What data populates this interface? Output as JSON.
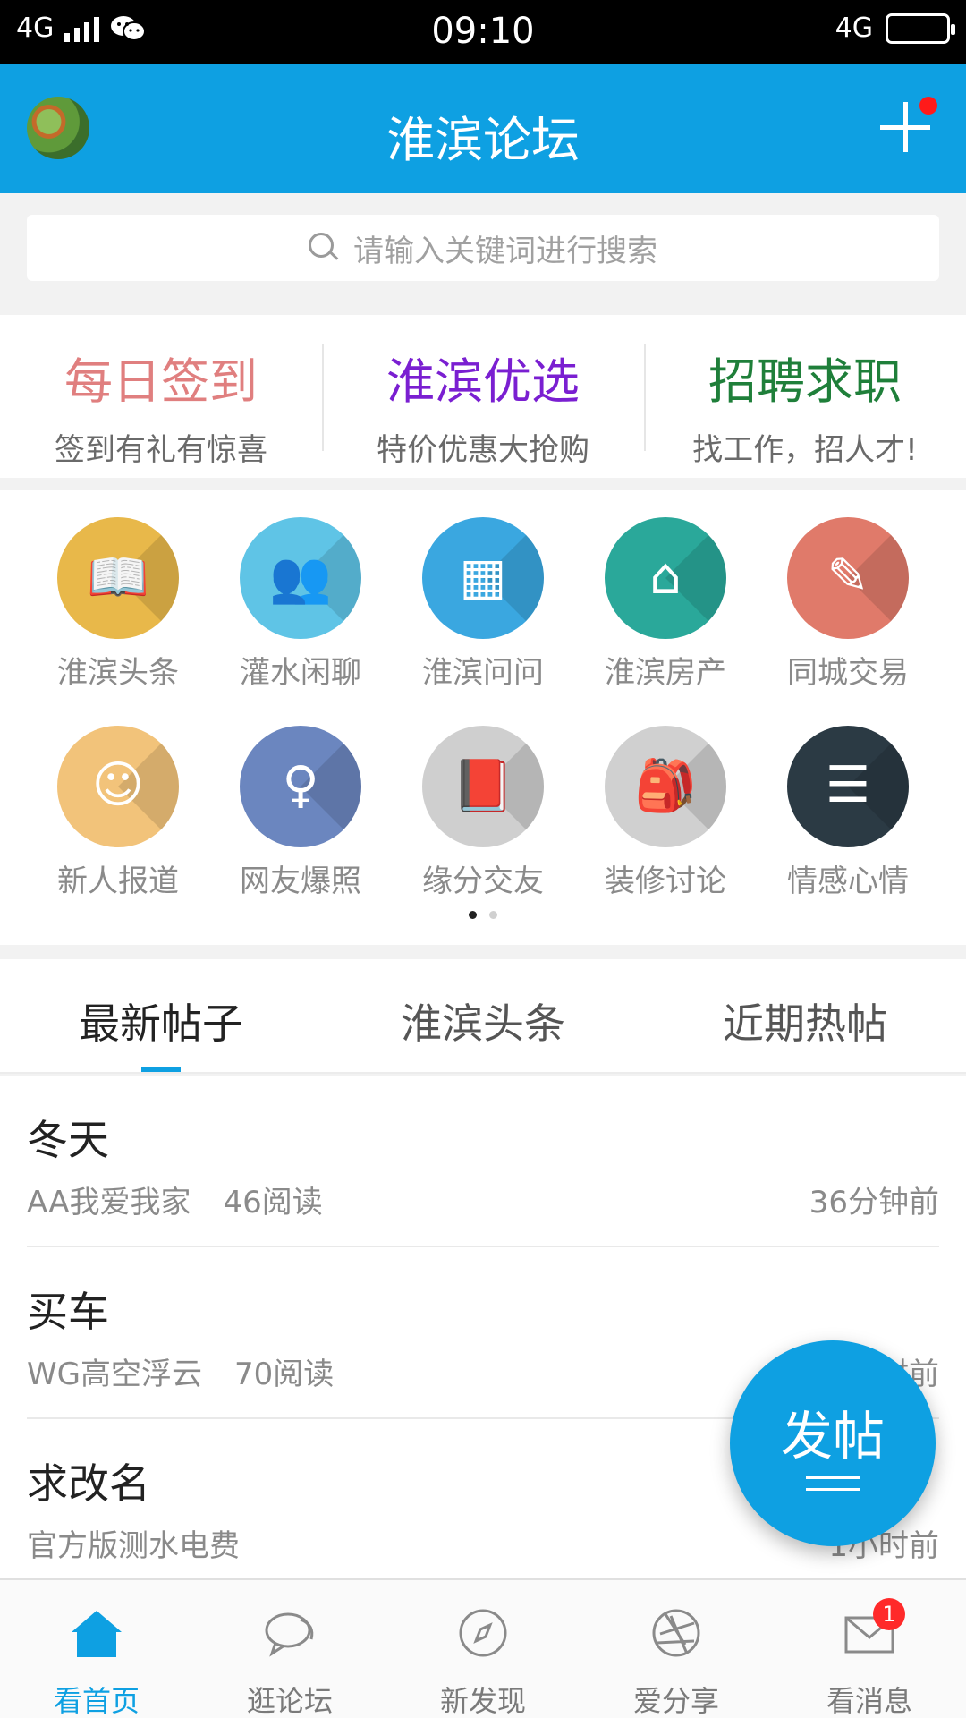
{
  "status_bar": {
    "network_left": "4G",
    "time": "09:10",
    "network_right": "4G"
  },
  "header": {
    "title": "淮滨论坛"
  },
  "search": {
    "placeholder": "请输入关键词进行搜索"
  },
  "promos": [
    {
      "title": "每日签到",
      "subtitle": "签到有礼有惊喜",
      "color": "#e07f7f"
    },
    {
      "title": "淮滨优选",
      "subtitle": "特价优惠大抢购",
      "color": "#7a1fd1"
    },
    {
      "title": "招聘求职",
      "subtitle": "找工作，招人才!",
      "color": "#1f7f3a"
    }
  ],
  "categories": [
    {
      "label": "淮滨头条",
      "icon": "reading-person-icon",
      "color": "#e8b84a"
    },
    {
      "label": "灌水闲聊",
      "icon": "lecture-hall-icon",
      "color": "#5fc4e6"
    },
    {
      "label": "淮滨问问",
      "icon": "number-blocks-icon",
      "color": "#3aa7e0"
    },
    {
      "label": "淮滨房产",
      "icon": "house-icon",
      "color": "#2aa89a"
    },
    {
      "label": "同城交易",
      "icon": "tools-calculator-icon",
      "color": "#e07a6a"
    },
    {
      "label": "新人报道",
      "icon": "newcomer-certificate-icon",
      "color": "#f2c37a"
    },
    {
      "label": "网友爆照",
      "icon": "woman-portrait-icon",
      "color": "#6b86bf"
    },
    {
      "label": "缘分交友",
      "icon": "girl-reading-icon",
      "color": "#cfcfcf"
    },
    {
      "label": "装修讨论",
      "icon": "toolbag-icon",
      "color": "#d0d0d0"
    },
    {
      "label": "情感心情",
      "icon": "notepad-icon",
      "color": "#2b3a44"
    }
  ],
  "tabs": [
    {
      "label": "最新帖子",
      "active": true
    },
    {
      "label": "淮滨头条",
      "active": false
    },
    {
      "label": "近期热帖",
      "active": false
    }
  ],
  "posts": [
    {
      "title": "冬天",
      "author": "AA我爱我家",
      "reads": "46阅读",
      "time": "36分钟前"
    },
    {
      "title": "买车",
      "author": "WG高空浮云",
      "reads": "70阅读",
      "time": "1小时前"
    },
    {
      "title": "求改名",
      "author": "官方版测水电费",
      "reads": "",
      "time": "1小时前"
    }
  ],
  "fab": {
    "label": "发帖"
  },
  "bottom_nav": [
    {
      "label": "看首页",
      "icon": "home-icon",
      "active": true
    },
    {
      "label": "逛论坛",
      "icon": "chat-bubble-icon",
      "active": false
    },
    {
      "label": "新发现",
      "icon": "compass-icon",
      "active": false
    },
    {
      "label": "爱分享",
      "icon": "aperture-icon",
      "active": false
    },
    {
      "label": "看消息",
      "icon": "mail-icon",
      "active": false,
      "badge": "1"
    }
  ],
  "colors": {
    "accent": "#0ea0e2",
    "badge": "#ff2a2a"
  }
}
